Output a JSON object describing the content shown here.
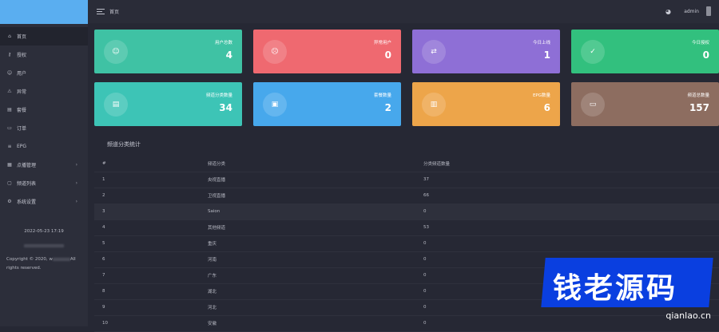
{
  "topbar": {
    "page_title": "首页",
    "username": "admin",
    "palette_icon": "palette-icon"
  },
  "sidebar": {
    "items": [
      {
        "label": "首页",
        "icon": "⌂",
        "has_arrow": false,
        "active": true
      },
      {
        "label": "授权",
        "icon": "⚷",
        "has_arrow": false,
        "active": false
      },
      {
        "label": "用户",
        "icon": "☺",
        "has_arrow": false,
        "active": false
      },
      {
        "label": "异常",
        "icon": "⚠",
        "has_arrow": false,
        "active": false
      },
      {
        "label": "套餐",
        "icon": "▤",
        "has_arrow": false,
        "active": false
      },
      {
        "label": "订单",
        "icon": "▭",
        "has_arrow": false,
        "active": false
      },
      {
        "label": "EPG",
        "icon": "≡",
        "has_arrow": false,
        "active": false
      },
      {
        "label": "点播管理",
        "icon": "▦",
        "has_arrow": true,
        "active": false
      },
      {
        "label": "频道列表",
        "icon": "▢",
        "has_arrow": true,
        "active": false
      },
      {
        "label": "系统设置",
        "icon": "⚙",
        "has_arrow": true,
        "active": false
      }
    ],
    "date": "2022-05-23 17:19",
    "copyright_prefix": "Copyright © 2020, w",
    "copyright_suffix": "All rights reserved."
  },
  "cards": [
    {
      "label": "用户总数",
      "value": "4",
      "icon": "☺"
    },
    {
      "label": "异常用户",
      "value": "0",
      "icon": "☹"
    },
    {
      "label": "今日上线",
      "value": "1",
      "icon": "⇄"
    },
    {
      "label": "今日授权",
      "value": "0",
      "icon": "✓"
    },
    {
      "label": "频道分类数量",
      "value": "34",
      "icon": "▤"
    },
    {
      "label": "套餐数量",
      "value": "2",
      "icon": "▣"
    },
    {
      "label": "EPG数量",
      "value": "6",
      "icon": "▥"
    },
    {
      "label": "频道总数量",
      "value": "157",
      "icon": "▭"
    }
  ],
  "table": {
    "title": "频道分类统计",
    "headers": [
      "#",
      "频道分类",
      "分类频道数量"
    ],
    "rows": [
      [
        "1",
        "央视直播",
        "37"
      ],
      [
        "2",
        "卫视直播",
        "66"
      ],
      [
        "3",
        "Saion",
        "0"
      ],
      [
        "4",
        "其他频道",
        "53"
      ],
      [
        "5",
        "重庆",
        "0"
      ],
      [
        "6",
        "河南",
        "0"
      ],
      [
        "7",
        "广东",
        "0"
      ],
      [
        "8",
        "湖北",
        "0"
      ],
      [
        "9",
        "河北",
        "0"
      ],
      [
        "10",
        "安徽",
        "0"
      ]
    ]
  },
  "watermark": {
    "text": "钱老源码",
    "url": "qianlao.cn"
  },
  "colors": {
    "card_teal": "#3fc2a4",
    "card_red": "#ef6970",
    "card_purple": "#8e6fd6",
    "card_green": "#32c07e",
    "card_cyan": "#3dc4b6",
    "card_blue": "#47a8ec",
    "card_orange": "#eda54a",
    "card_brown": "#8d6d60",
    "watermark_blue": "#0a3fe0",
    "background": "#262834"
  }
}
